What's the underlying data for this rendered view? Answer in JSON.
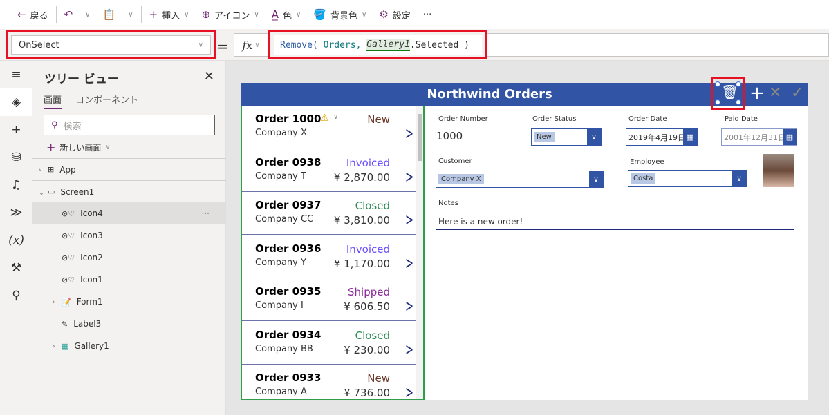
{
  "toolbar": {
    "back": "戻る",
    "insert": "挿入",
    "icon": "アイコン",
    "color": "色",
    "bgcolor": "背景色",
    "settings": "設定",
    "more": "···"
  },
  "formula": {
    "property": "OnSelect",
    "equals": "=",
    "fx": "fx",
    "fn": "Remove(",
    "arg1": " Orders, ",
    "ctl": "Gallery1",
    ".Selected": ".Selected )",
    "prop": ".Selected )"
  },
  "tree": {
    "title": "ツリー ビュー",
    "tabs": [
      "画面",
      "コンポーネント"
    ],
    "search_placeholder": "検索",
    "new_screen": "新しい画面",
    "items": [
      "App",
      "Screen1",
      "Icon4",
      "Icon3",
      "Icon2",
      "Icon1",
      "Form1",
      "Label3",
      "Gallery1"
    ],
    "more": "···"
  },
  "app": {
    "title": "Northwind Orders",
    "orders": [
      {
        "name": "Order 1000",
        "company": "Company X",
        "status": "New",
        "amount": ""
      },
      {
        "name": "Order 0938",
        "company": "Company T",
        "status": "Invoiced",
        "amount": "¥ 2,870.00"
      },
      {
        "name": "Order 0937",
        "company": "Company CC",
        "status": "Closed",
        "amount": "¥ 3,810.00"
      },
      {
        "name": "Order 0936",
        "company": "Company Y",
        "status": "Invoiced",
        "amount": "¥ 1,170.00"
      },
      {
        "name": "Order 0935",
        "company": "Company I",
        "status": "Shipped",
        "amount": "¥ 606.50"
      },
      {
        "name": "Order 0934",
        "company": "Company BB",
        "status": "Closed",
        "amount": "¥ 230.00"
      },
      {
        "name": "Order 0933",
        "company": "Company A",
        "status": "New",
        "amount": "¥ 736.00"
      }
    ],
    "status_colors": {
      "New": "#6b3a2a",
      "Invoiced": "#6a4cff",
      "Closed": "#2e8b57",
      "Shipped": "#8b2a9b"
    },
    "form": {
      "order_number_label": "Order Number",
      "order_number": "1000",
      "order_status_label": "Order Status",
      "order_status": "New",
      "order_date_label": "Order Date",
      "order_date": "2019年4月19日",
      "paid_date_label": "Paid Date",
      "paid_date": "2001年12月31日",
      "customer_label": "Customer",
      "customer": "Company X",
      "employee_label": "Employee",
      "employee": "Costa",
      "notes_label": "Notes",
      "notes": "Here is a new order!"
    }
  },
  "colors": {
    "header": "#3155a4",
    "accent": "#742774",
    "highlight": "#e81123"
  }
}
